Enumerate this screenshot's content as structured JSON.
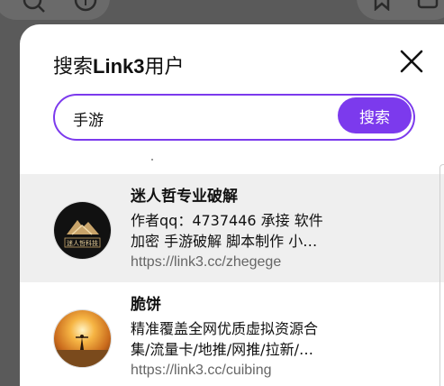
{
  "dialog": {
    "title_prefix": "搜索",
    "title_brand": "Link3",
    "title_suffix": "用户"
  },
  "search": {
    "query": "手游",
    "button_label": "搜索"
  },
  "results": [
    {
      "name": "迷人哲专业破解",
      "desc_line1": "作者qq：4737446 承接 软件",
      "desc_line2": "加密 手游破解 脚本制作 小…",
      "url": "https://link3.cc/zhegege",
      "avatar_text": "迷人哲科技"
    },
    {
      "name": "脆饼",
      "desc_line1": "精准覆盖全网优质虚拟资源合",
      "desc_line2": "集/流量卡/地推/网推/拉新/…",
      "url": "https://link3.cc/cuibing"
    }
  ],
  "colors": {
    "accent": "#7c3aed"
  }
}
